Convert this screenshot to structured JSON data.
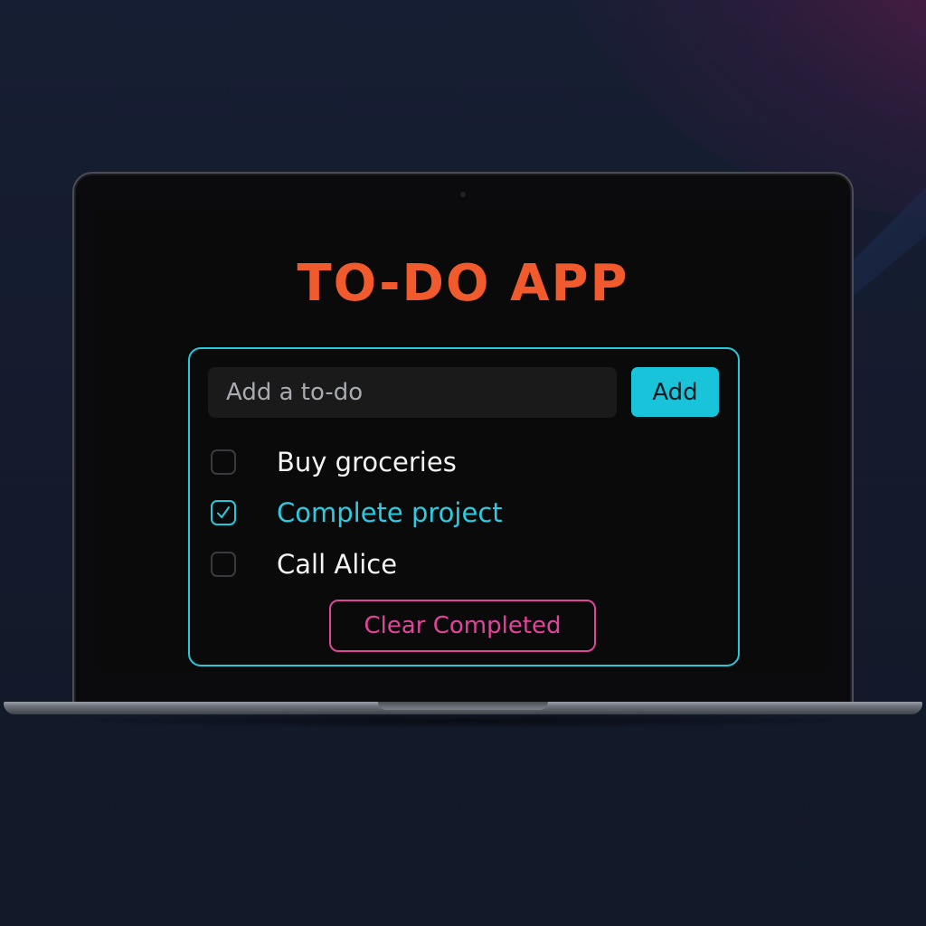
{
  "app": {
    "title": "TO-DO APP"
  },
  "input": {
    "placeholder": "Add a to-do",
    "value": ""
  },
  "add_button": {
    "label": "Add"
  },
  "todos": [
    {
      "label": "Buy groceries",
      "completed": false
    },
    {
      "label": "Complete project",
      "completed": true
    },
    {
      "label": "Call Alice",
      "completed": false
    }
  ],
  "clear_button": {
    "label": "Clear Completed"
  },
  "icons": {
    "checkbox_checked": "checkmark-icon"
  },
  "colors": {
    "title": "#f05a2c",
    "card_border": "#27c8d9",
    "accent": "#19c4db",
    "completed_text": "#2ccbe0",
    "clear_button": "#e0459a",
    "screen_background": "#0a0a0a"
  }
}
